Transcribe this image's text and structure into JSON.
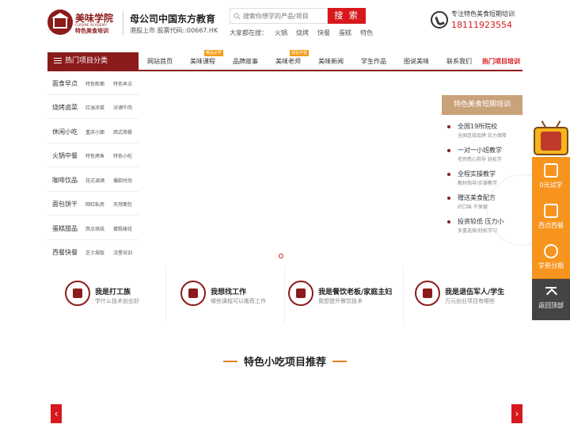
{
  "header": {
    "brand_name": "美味学院",
    "brand_en": "CUISINE ACADEMY",
    "brand_sub": "特色美食培训",
    "parent_company": "母公司中国东方教育",
    "stock_info": "港股上市 股票代码::00667.HK",
    "search_placeholder": "搜索你想学的产品/项目",
    "search_button": "搜 索",
    "hot_label": "大家都在搜：",
    "hot_terms": [
      "火锅",
      "烧烤",
      "快餐",
      "蛋糕",
      "特色"
    ],
    "phone_tagline": "专注特色美食短期培训",
    "phone_number": "18111923554"
  },
  "nav": {
    "category_label": "热门项目分类",
    "items": [
      {
        "label": "网站首页",
        "badge": ""
      },
      {
        "label": "美味课程",
        "badge": "精品必学"
      },
      {
        "label": "品牌故事",
        "badge": ""
      },
      {
        "label": "美味老师",
        "badge": "经验丰富"
      },
      {
        "label": "美味新闻",
        "badge": ""
      },
      {
        "label": "学生作品",
        "badge": ""
      },
      {
        "label": "图说美味",
        "badge": ""
      },
      {
        "label": "联系我们",
        "badge": ""
      },
      {
        "label": "热门项目培训",
        "badge": ""
      }
    ]
  },
  "sidebar": {
    "rows": [
      {
        "main": "面食早点",
        "a": "特色粉面",
        "b": "特色早点"
      },
      {
        "main": "烧烤卤菜",
        "a": "红油凉菜",
        "b": "汾酒牛肉"
      },
      {
        "main": "休闲小吃",
        "a": "重庆小面",
        "b": "西式简餐"
      },
      {
        "main": "火锅中餐",
        "a": "特色烤鱼",
        "b": "特色小吃"
      },
      {
        "main": "咖啡饮品",
        "a": "花式调酒",
        "b": "爆款时尚"
      },
      {
        "main": "面包饼干",
        "a": "网红私房",
        "b": "天然面包"
      },
      {
        "main": "蛋糕甜品",
        "a": "西点烘焙",
        "b": "蛋糕裱花"
      },
      {
        "main": "西餐快餐",
        "a": "芝士焗饭",
        "b": "汉堡培训"
      }
    ]
  },
  "features": {
    "heading": "特色美食短期培训",
    "items": [
      {
        "title": "全国19所院校",
        "sub": "全国连锁品牌 实力保障"
      },
      {
        "title": "一对一小班教学",
        "sub": "老师悉心指导 轻松学"
      },
      {
        "title": "全程实操教学",
        "sub": "教材指导/实操教学"
      },
      {
        "title": "赠送美食配方",
        "sub": "好口味 不保留"
      },
      {
        "title": "投资较低 压力小",
        "sub": "多重选择/轻松学习"
      }
    ]
  },
  "intents": [
    {
      "title": "我是打工族",
      "sub": "学什么技术创业好",
      "icon": "worker-icon"
    },
    {
      "title": "我想找工作",
      "sub": "哪些课程可以推荐工作",
      "icon": "chef-hat-icon"
    },
    {
      "title": "我是餐饮老板/家庭主妇",
      "sub": "我想提升餐饮技术",
      "icon": "shop-icon"
    },
    {
      "title": "我是退伍军人/学生",
      "sub": "万元创业项目有哪些",
      "icon": "soldier-icon"
    }
  ],
  "section": {
    "title": "特色小吃项目推荐"
  },
  "float_bar": {
    "buttons": [
      {
        "label": "0元试学",
        "icon": "lock-icon"
      },
      {
        "label": "西点西餐",
        "icon": "calendar-icon"
      },
      {
        "label": "学费分期",
        "icon": "coin-icon"
      },
      {
        "label": "返回顶部",
        "icon": "back-top-icon"
      }
    ]
  },
  "colors": {
    "brand": "#8b1a1a",
    "accent_red": "#d7191e",
    "float_orange": "#f7941e",
    "feature_tan": "#c9a27a"
  }
}
